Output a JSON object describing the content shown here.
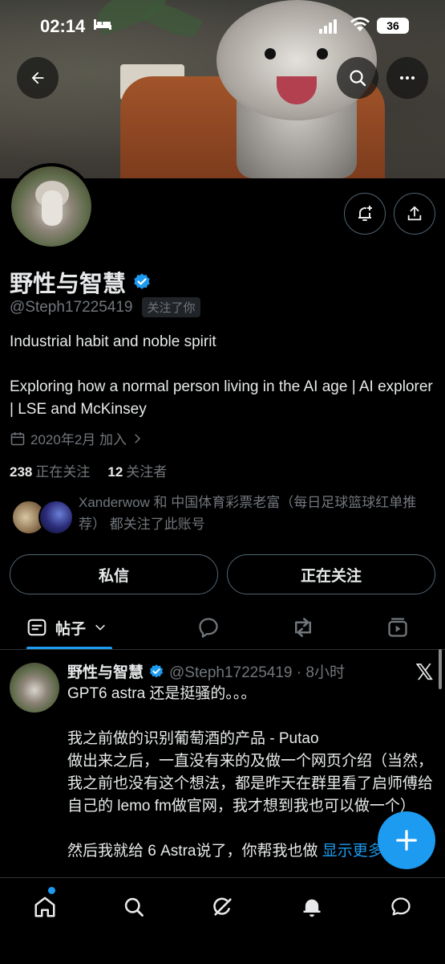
{
  "status_bar": {
    "time": "02:14",
    "battery": "36",
    "icons": [
      "bed-icon",
      "signal-icon",
      "wifi-icon",
      "battery-icon"
    ]
  },
  "header": {
    "back_icon": "arrow-left-icon",
    "search_icon": "search-icon",
    "more_icon": "more-icon"
  },
  "profile": {
    "name": "野性与智慧",
    "handle": "@Steph17225419",
    "follows_you": "关注了你",
    "bio_line1": "Industrial habit and noble spirit",
    "bio_line2": "Exploring how a normal person living in the AI age | AI explorer | LSE and McKinsey",
    "joined": "2020年2月 加入",
    "following_count": "238",
    "following_label": "正在关注",
    "followers_count": "12",
    "followers_label": "关注者",
    "mutuals_text": "Xanderwow 和 中国体育彩票老富（每日足球篮球红单推荐） 都关注了此账号",
    "verified_color": "#1d9bf0"
  },
  "actions": {
    "message_label": "私信",
    "following_label": "正在关注"
  },
  "tabs": {
    "posts_label": "帖子",
    "icons": [
      "reply-icon",
      "retweet-icon",
      "media-icon"
    ]
  },
  "tweet": {
    "name": "野性与智慧",
    "handle_time": "@Steph17225419 · 8小时",
    "body": "GPT6 astra 还是挺骚的。。。\n\n我之前做的识别葡萄酒的产品 - Putao\n做出来之后，一直没有来的及做一个网页介绍（当然，我之前也没有这个想法，都是昨天在群里看了启师傅给自己的 lemo fm做官网，我才想到我也可以做一个）\n\n然后我就给 6 Astra说了，你帮我也做 ",
    "show_more": "显示更多",
    "x_logo": "𝕏"
  },
  "fab": {
    "icon": "plus-icon"
  },
  "bottom_nav": {
    "items": [
      "home-icon",
      "search-icon",
      "grok-icon",
      "notifications-icon",
      "messages-icon"
    ]
  },
  "colors": {
    "accent": "#1d9bf0",
    "secondary_text": "#71767b",
    "border": "#536471"
  }
}
